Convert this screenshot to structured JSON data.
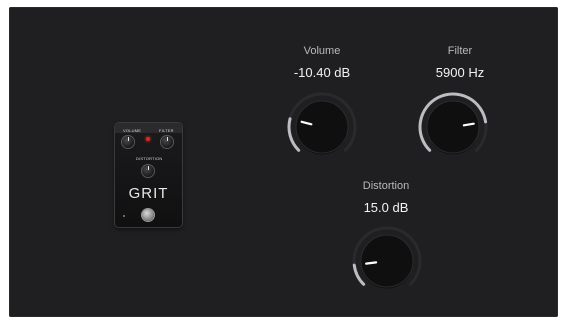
{
  "pedal": {
    "brand": "GRIT",
    "knob_labels": [
      "VOLUME",
      "FILTER"
    ],
    "center_label": "DISTORTION"
  },
  "controls": [
    {
      "id": "volume",
      "label": "Volume",
      "value": "-10.40 dB",
      "level": 0.22
    },
    {
      "id": "filter",
      "label": "Filter",
      "value": "5900 Hz",
      "level": 0.8
    },
    {
      "id": "distortion",
      "label": "Distortion",
      "value": "15.0 dB",
      "level": 0.14
    }
  ],
  "colors": {
    "panel": "#1f1f21",
    "knob": "#0f0f10",
    "arc_track": "#2a2a2d",
    "arc_fill": "#bdbdc1",
    "indicator": "#ffffff"
  }
}
